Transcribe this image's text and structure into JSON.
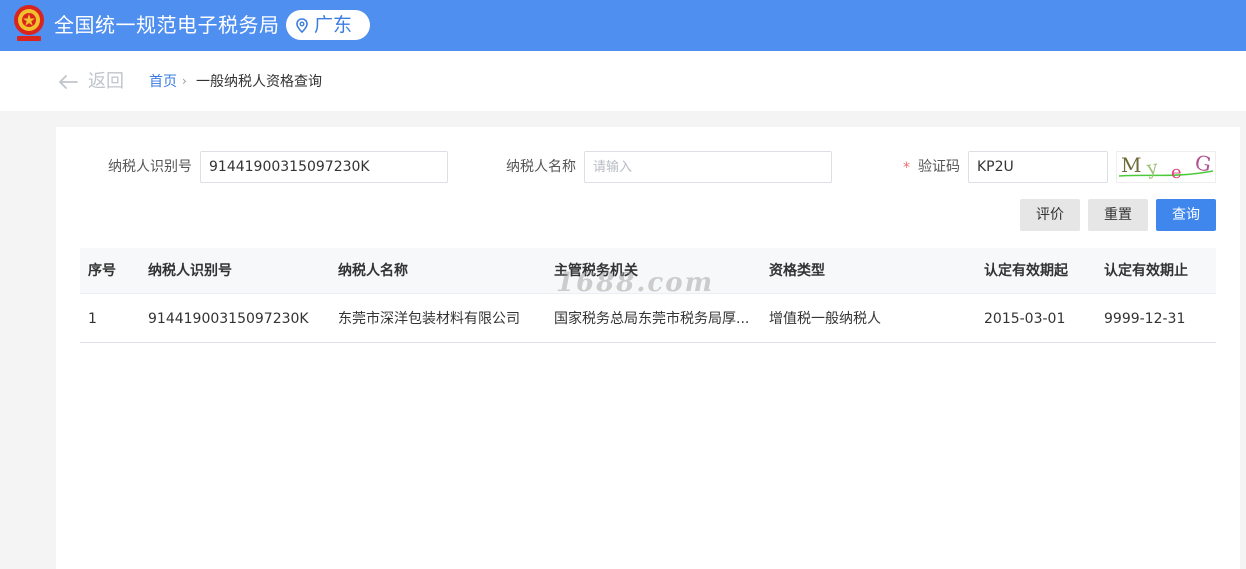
{
  "header": {
    "title": "全国统一规范电子税务局",
    "region": "广东"
  },
  "nav": {
    "back_label": "返回",
    "breadcrumb": [
      "首页",
      "一般纳税人资格查询"
    ]
  },
  "form": {
    "taxpayer_id": {
      "label": "纳税人识别号",
      "value": "91441900315097230K"
    },
    "taxpayer_name": {
      "label": "纳税人名称",
      "placeholder": "请输入",
      "value": ""
    },
    "captcha": {
      "label": "验证码",
      "required_mark": "*",
      "value": "KP2U",
      "image_text": "MyeG"
    }
  },
  "buttons": {
    "evaluate": "评价",
    "reset": "重置",
    "query": "查询"
  },
  "table": {
    "columns": [
      "序号",
      "纳税人识别号",
      "纳税人名称",
      "主管税务机关",
      "资格类型",
      "认定有效期起",
      "认定有效期止"
    ],
    "rows": [
      [
        "1",
        "91441900315097230K",
        "东莞市深洋包装材料有限公司",
        "国家税务总局东莞市税务局厚...",
        "增值税一般纳税人",
        "2015-03-01",
        "9999-12-31"
      ]
    ]
  },
  "watermark": "1688.com",
  "colors": {
    "header_bg": "#4f8ff0",
    "primary": "#3f87ec",
    "link": "#3b7de0",
    "required": "#f56c6c"
  },
  "icons": {
    "emblem": "national-emblem-icon",
    "region": "location-pin-icon",
    "back": "arrow-left-icon"
  }
}
